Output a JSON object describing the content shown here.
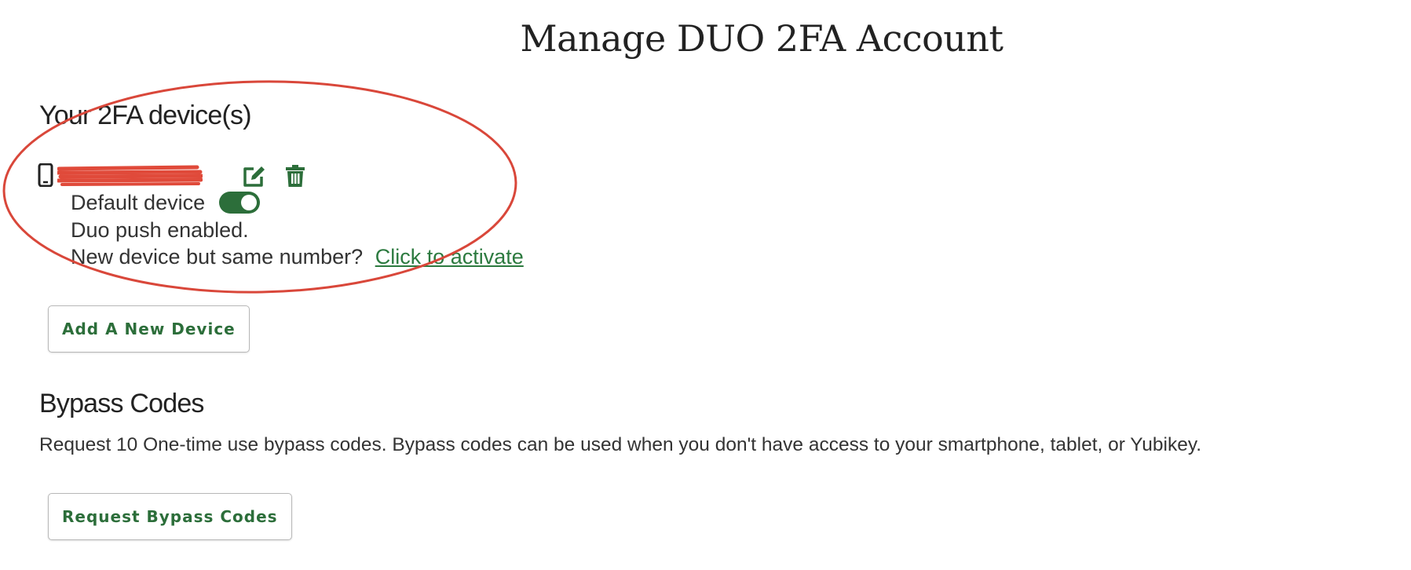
{
  "page_title": "Manage DUO 2FA Account",
  "devices_section": {
    "heading": "Your 2FA device(s)",
    "device": {
      "icon": "mobile-phone-icon",
      "name": "",
      "name_redacted": true,
      "edit_icon": "edit-icon",
      "delete_icon": "trash-icon",
      "default_label": "Default device",
      "default_toggle_on": true,
      "push_status": "Duo push enabled.",
      "same_number_prompt": "New device but same number?",
      "activate_link": "Click to activate"
    },
    "add_button_label": "Add A New Device"
  },
  "bypass_section": {
    "heading": "Bypass Codes",
    "description": "Request 10 One-time use bypass codes. Bypass codes can be used when you don't have access to your smartphone, tablet, or Yubikey.",
    "request_button_label": "Request Bypass Codes"
  },
  "colors": {
    "accent_green": "#2c6e3a",
    "link_green": "#2c7a3f",
    "annotation_red": "#d9473a"
  }
}
